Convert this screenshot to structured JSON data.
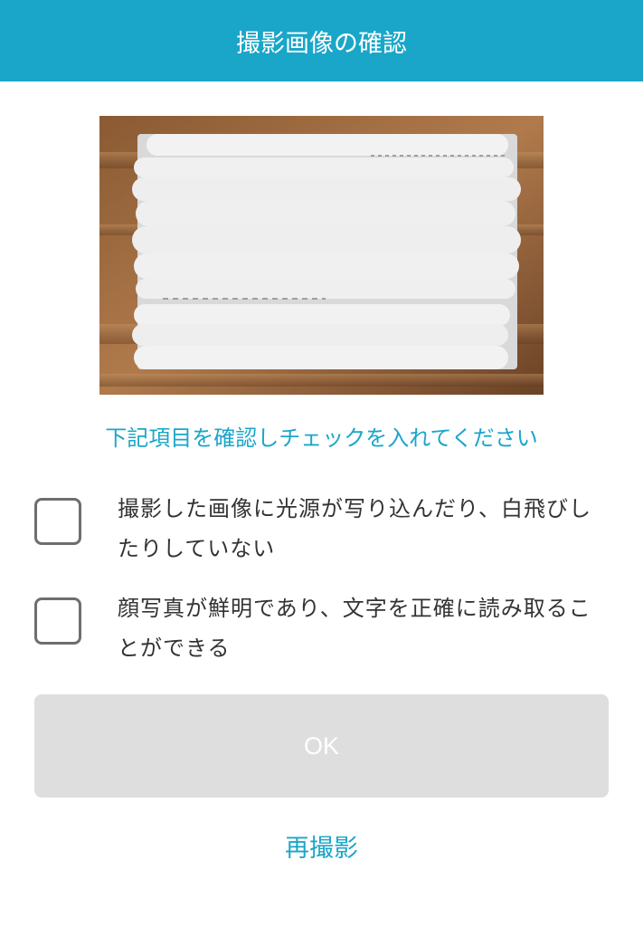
{
  "colors": {
    "accent": "#1aa6c8",
    "button_disabled_bg": "#dedede",
    "text_primary": "#333333"
  },
  "header": {
    "title": "撮影画像の確認"
  },
  "photo": {
    "description_icon": "card-photo-redacted"
  },
  "instruction": {
    "text": "下記項目を確認しチェックを入れてください"
  },
  "checks": [
    {
      "label": "撮影した画像に光源が写り込んだり、白飛びしたりしていない",
      "checked": false
    },
    {
      "label": "顔写真が鮮明であり、文字を正確に読み取ることができる",
      "checked": false
    }
  ],
  "ok_button": {
    "label": "OK",
    "enabled": false
  },
  "retake": {
    "label": "再撮影"
  }
}
